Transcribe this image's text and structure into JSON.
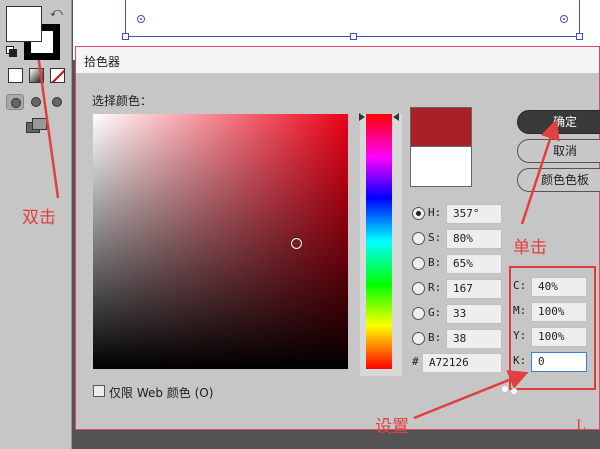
{
  "dialog": {
    "title": "拾色器",
    "select_color_label": "选择颜色：",
    "ok_label": "确定",
    "cancel_label": "取消",
    "swatches_label": "颜色色板",
    "web_only_label": "仅限 Web 颜色 (O)",
    "new_color": "#a72126",
    "current_color": "#ffffff",
    "hsb_fields": [
      {
        "label": "H:",
        "value": "357°",
        "selected": true
      },
      {
        "label": "S:",
        "value": "80%",
        "selected": false
      },
      {
        "label": "B:",
        "value": "65%",
        "selected": false
      }
    ],
    "rgb_fields": [
      {
        "label": "R:",
        "value": "167",
        "selected": false
      },
      {
        "label": "G:",
        "value": "33",
        "selected": false
      },
      {
        "label": "B:",
        "value": "38",
        "selected": false
      }
    ],
    "hex_label": "#",
    "hex_value": "A72126",
    "cmyk_fields": [
      {
        "label": "C:",
        "value": "40%"
      },
      {
        "label": "M:",
        "value": "100%"
      },
      {
        "label": "Y:",
        "value": "100%"
      },
      {
        "label": "K:",
        "value": "0"
      }
    ]
  },
  "toolbar": {
    "fill_color": "#ffffff",
    "stroke_color": "#000000"
  },
  "annotations": {
    "double_click": "双击",
    "single_click": "单击",
    "set": "设置",
    "mark": "L"
  },
  "colors": {
    "annotation_red": "#e0403f",
    "hue_base": "#ec0016",
    "selection_blue": "#3b4fc4"
  }
}
